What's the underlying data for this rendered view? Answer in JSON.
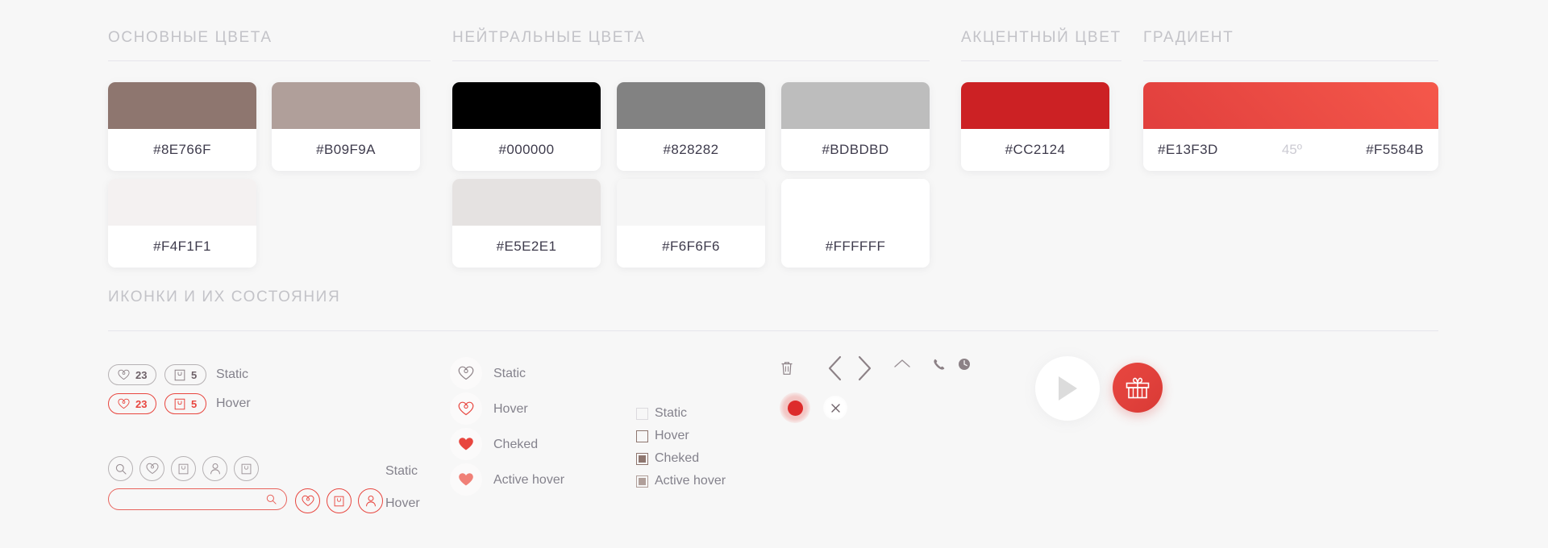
{
  "sections": {
    "primary": {
      "title": "ОСНОВНЫЕ ЦВЕТА"
    },
    "neutral": {
      "title": "НЕЙТРАЛЬНЫЕ ЦВЕТА"
    },
    "accent": {
      "title": "АКЦЕНТНЫЙ ЦВЕТ"
    },
    "gradient": {
      "title": "ГРАДИЕНТ"
    },
    "icons": {
      "title": "ИКОНКИ И ИХ СОСТОЯНИЯ"
    }
  },
  "palette": {
    "primary": [
      {
        "hex": "#8E766F"
      },
      {
        "hex": "#B09F9A"
      },
      {
        "hex": "#F4F1F1"
      }
    ],
    "neutral": [
      {
        "hex": "#000000"
      },
      {
        "hex": "#828282"
      },
      {
        "hex": "#BDBDBD"
      },
      {
        "hex": "#E5E2E1"
      },
      {
        "hex": "#F6F6F6"
      },
      {
        "hex": "#FFFFFF"
      }
    ],
    "accent": [
      {
        "hex": "#CC2124"
      }
    ],
    "gradient": {
      "from": "#E13F3D",
      "angle": "45º",
      "to": "#F5584B"
    }
  },
  "icon_states": {
    "counters": {
      "rows": [
        {
          "state": "Static",
          "likes": "23",
          "bag": "5"
        },
        {
          "state": "Hover",
          "likes": "23",
          "bag": "5"
        }
      ]
    },
    "hearts": [
      {
        "state": "Static"
      },
      {
        "state": "Hover"
      },
      {
        "state": "Cheked"
      },
      {
        "state": "Active hover"
      }
    ],
    "checkboxes": [
      {
        "state": "Static"
      },
      {
        "state": "Hover"
      },
      {
        "state": "Cheked"
      },
      {
        "state": "Active hover"
      }
    ],
    "nav_row": [
      "trash-icon",
      "chevron-left-icon",
      "chevron-right-icon",
      "chevron-up-icon",
      "phone-icon",
      "clock-icon"
    ],
    "toolbar": {
      "static_label": "Static",
      "hover_label": "Hover",
      "search_placeholder": "",
      "search_value": ""
    }
  }
}
